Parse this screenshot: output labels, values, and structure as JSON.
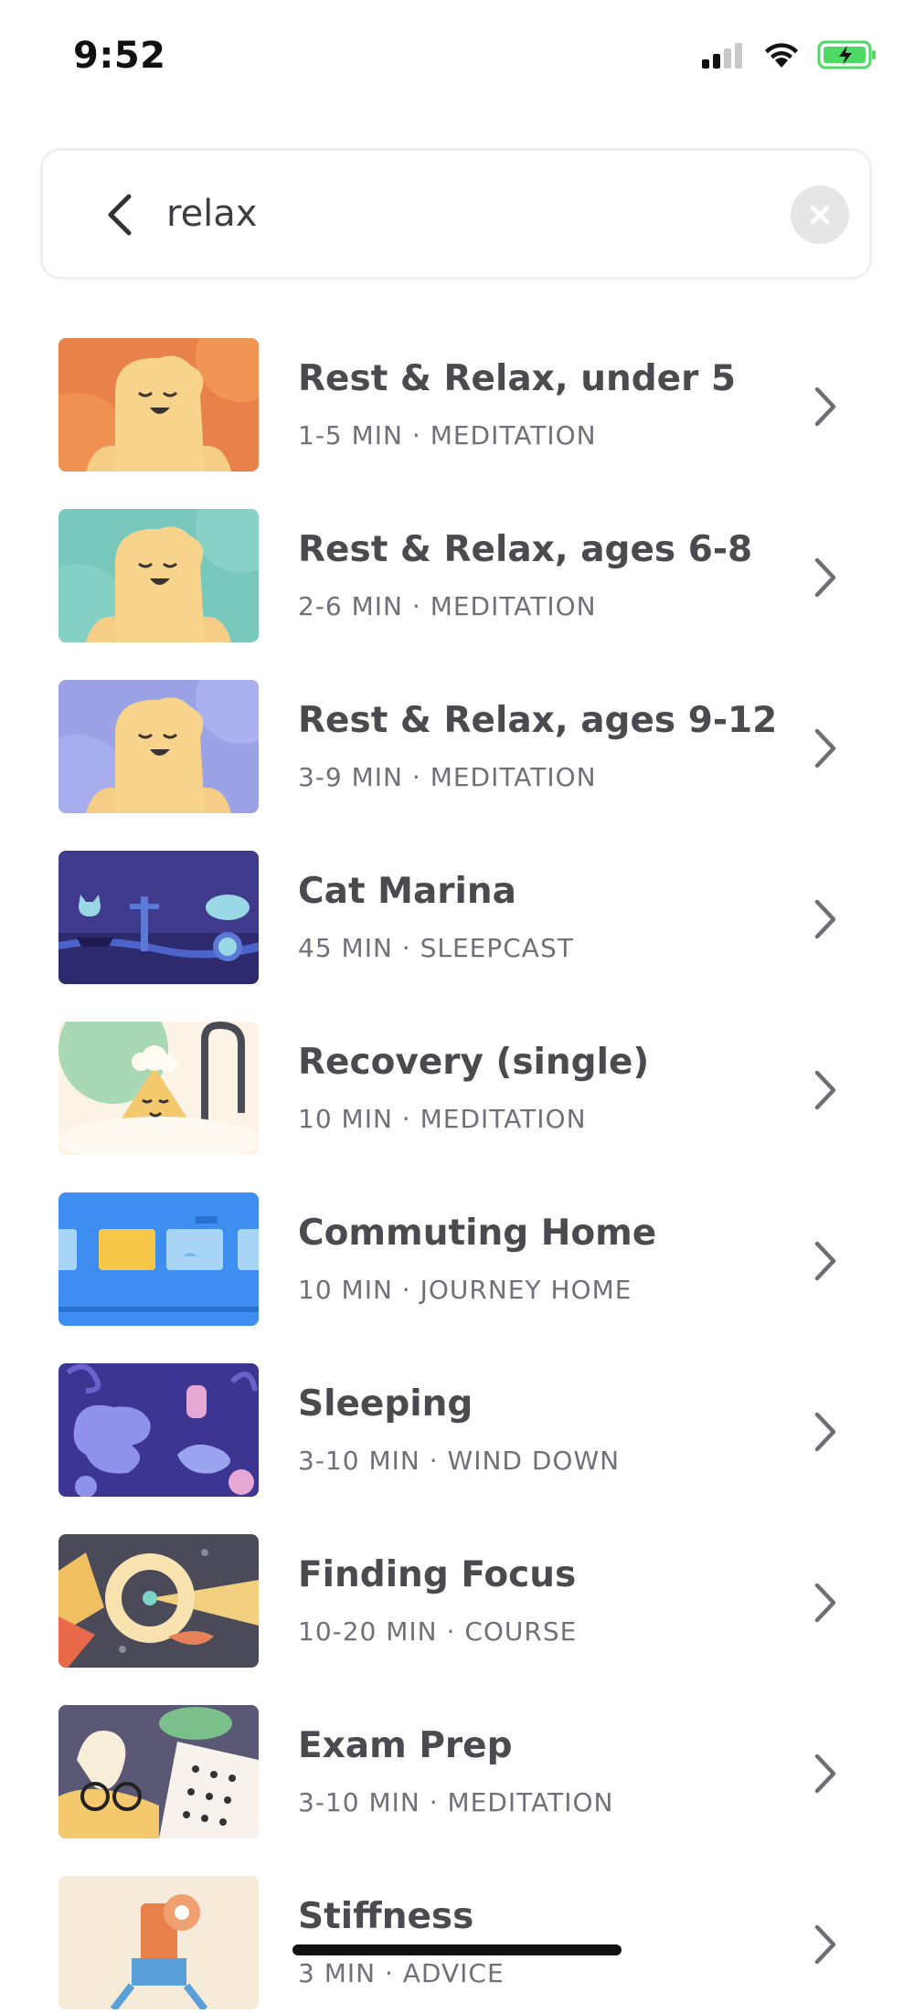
{
  "status_bar": {
    "time": "9:52"
  },
  "search": {
    "query": "relax"
  },
  "results": [
    {
      "title": "Rest & Relax, under 5",
      "subtitle": "1-5 MIN · MEDITATION",
      "thumbnail": "orange-character"
    },
    {
      "title": "Rest & Relax, ages 6-8",
      "subtitle": "2-6 MIN · MEDITATION",
      "thumbnail": "teal-character"
    },
    {
      "title": "Rest & Relax, ages 9-12",
      "subtitle": "3-9 MIN · MEDITATION",
      "thumbnail": "lavender-character"
    },
    {
      "title": "Cat Marina",
      "subtitle": "45 MIN · SLEEPCAST",
      "thumbnail": "night-marina"
    },
    {
      "title": "Recovery (single)",
      "subtitle": "10 MIN · MEDITATION",
      "thumbnail": "bath"
    },
    {
      "title": "Commuting Home",
      "subtitle": "10 MIN · JOURNEY HOME",
      "thumbnail": "train"
    },
    {
      "title": "Sleeping",
      "subtitle": "3-10 MIN · WIND DOWN",
      "thumbnail": "sleeping-creatures"
    },
    {
      "title": "Finding Focus",
      "subtitle": "10-20 MIN · COURSE",
      "thumbnail": "focus-lens"
    },
    {
      "title": "Exam Prep",
      "subtitle": "3-10 MIN · MEDITATION",
      "thumbnail": "exam-paper"
    },
    {
      "title": "Stiffness",
      "subtitle": "3 MIN · ADVICE",
      "thumbnail": "stretch"
    }
  ],
  "colors": {
    "title": "#4a4a4f",
    "subtitle": "#707078",
    "chevron": "#6e6e73",
    "battery": "#4cd964"
  }
}
